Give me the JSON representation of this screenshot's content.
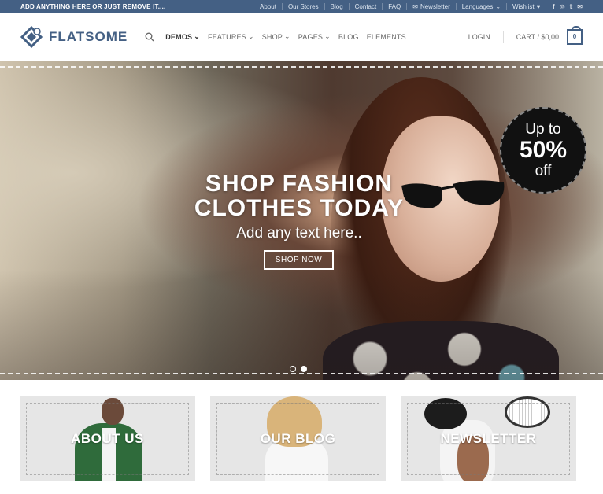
{
  "topbar": {
    "promo": "ADD ANYTHING HERE OR JUST REMOVE IT....",
    "links": [
      "About",
      "Our Stores",
      "Blog",
      "Contact",
      "FAQ",
      "Newsletter",
      "Languages",
      "Wishlist"
    ],
    "social_icons": [
      "facebook-icon",
      "instagram-icon",
      "twitter-icon",
      "email-icon"
    ]
  },
  "header": {
    "logo": "FLATSOME",
    "nav": [
      {
        "label": "DEMOS",
        "dropdown": true,
        "active": true
      },
      {
        "label": "FEATURES",
        "dropdown": true
      },
      {
        "label": "SHOP",
        "dropdown": true
      },
      {
        "label": "PAGES",
        "dropdown": true
      },
      {
        "label": "BLOG",
        "dropdown": false
      },
      {
        "label": "ELEMENTS",
        "dropdown": false
      }
    ],
    "login": "LOGIN",
    "cart": "CART / $0,00",
    "cart_count": "0"
  },
  "hero": {
    "headline_line1": "SHOP FASHION",
    "headline_line2": "CLOTHES TODAY",
    "subline": "Add any text here..",
    "cta": "SHOP NOW",
    "badge_line1": "Up to",
    "badge_line2": "50%",
    "badge_line3": "off",
    "slides": 2,
    "active_slide": 2
  },
  "categories": [
    {
      "label": "ABOUT US"
    },
    {
      "label": "OUR BLOG"
    },
    {
      "label": "NEWSLETTER"
    }
  ],
  "colors": {
    "primary": "#446084",
    "topbar_bg": "#446084",
    "badge_bg": "#111111"
  }
}
